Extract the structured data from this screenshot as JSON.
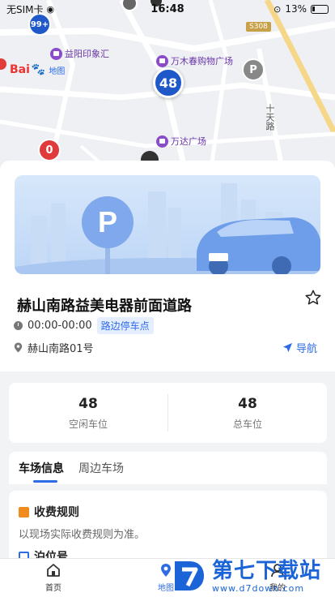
{
  "status_bar": {
    "carrier": "无SIM卡",
    "time": "16:48",
    "battery": "13%"
  },
  "map": {
    "pois": [
      "益阳印象汇",
      "万木春购物广场",
      "万达广场"
    ],
    "baidu_logo": "Bai",
    "baidu_logo_map": "地图",
    "road_sign": "S308",
    "road_label": "十天路",
    "clusters": {
      "top_left": "99+",
      "center": "48",
      "bottom_left": "0"
    }
  },
  "parking": {
    "name": "赫山南路益美电器前面道路",
    "hours": "00:00-00:00",
    "type_tag": "路边停车点",
    "address": "赫山南路01号",
    "navigate_label": "导航"
  },
  "stats": [
    {
      "value": "48",
      "label": "空闲车位"
    },
    {
      "value": "48",
      "label": "总车位"
    }
  ],
  "tabs": [
    {
      "label": "车场信息",
      "active": true
    },
    {
      "label": "周边车场",
      "active": false
    }
  ],
  "info": {
    "fee_title": "收费规则",
    "fee_text": "以现场实际收费规则为准。",
    "berth_title": "泊位号"
  },
  "bottom_nav": [
    {
      "label": "首页",
      "icon": "home-icon"
    },
    {
      "label": "地图",
      "icon": "map-pin-icon"
    },
    {
      "label": "我的",
      "icon": "user-icon"
    }
  ],
  "watermark": {
    "cn": "第七下载站",
    "url": "www.d7down.com"
  },
  "colors": {
    "accent": "#2e6be6",
    "cluster_blue": "#1f58c9",
    "cluster_red": "#e03a3a",
    "poi_purple": "#8a4cc9"
  }
}
